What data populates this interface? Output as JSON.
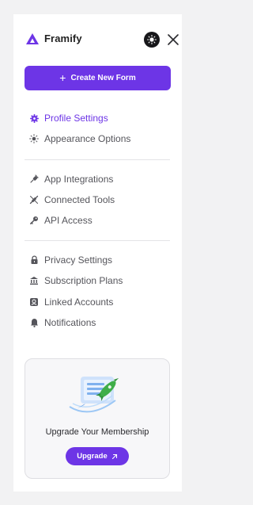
{
  "brand": {
    "name": "Framify"
  },
  "colors": {
    "accent": "#6d35e6",
    "text": "#55555b",
    "divider": "#e4e4e7"
  },
  "create_button": {
    "label": "Create New Form",
    "icon": "plus-icon"
  },
  "nav": {
    "group1": [
      {
        "label": "Profile Settings",
        "icon": "gear-icon",
        "active": true
      },
      {
        "label": "Appearance Options",
        "icon": "sun-icon",
        "active": false
      }
    ],
    "group2": [
      {
        "label": "App Integrations",
        "icon": "plug-icon"
      },
      {
        "label": "Connected Tools",
        "icon": "unplug-icon"
      },
      {
        "label": "API Access",
        "icon": "key-icon"
      }
    ],
    "group3": [
      {
        "label": "Privacy Settings",
        "icon": "lock-icon"
      },
      {
        "label": "Subscription Plans",
        "icon": "bank-icon"
      },
      {
        "label": "Linked Accounts",
        "icon": "linked-accounts-icon"
      },
      {
        "label": "Notifications",
        "icon": "bell-icon"
      }
    ]
  },
  "upgrade_card": {
    "title": "Upgrade Your Membership",
    "button_label": "Upgrade",
    "button_icon": "arrow-up-right-icon"
  }
}
